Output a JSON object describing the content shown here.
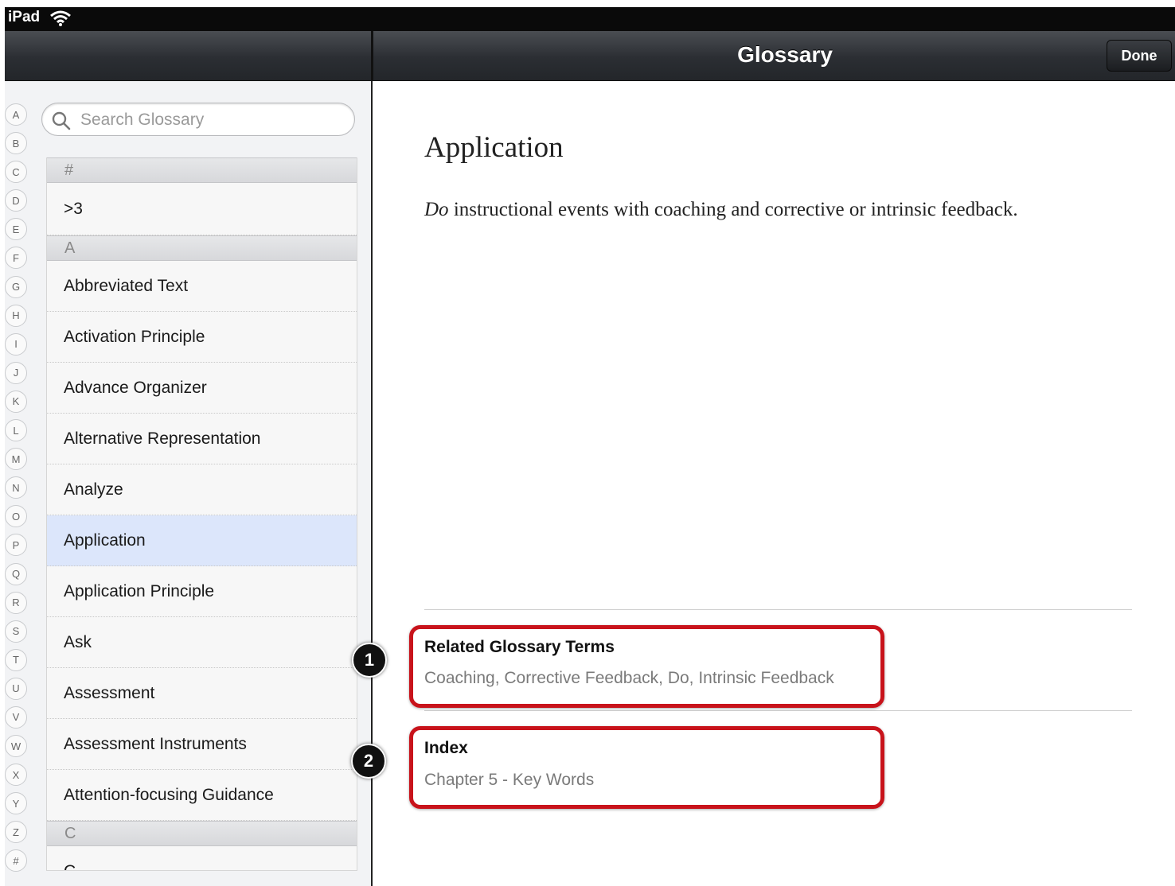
{
  "status_bar": {
    "carrier": "iPad"
  },
  "nav": {
    "title": "Glossary",
    "done_label": "Done"
  },
  "index_letters": [
    "A",
    "B",
    "C",
    "D",
    "E",
    "F",
    "G",
    "H",
    "I",
    "J",
    "K",
    "L",
    "M",
    "N",
    "O",
    "P",
    "Q",
    "R",
    "S",
    "T",
    "U",
    "V",
    "W",
    "X",
    "Y",
    "Z",
    "#"
  ],
  "search": {
    "placeholder": "Search Glossary"
  },
  "list": {
    "sections": [
      {
        "header": "#",
        "items": [
          ">3"
        ]
      },
      {
        "header": "A",
        "items": [
          "Abbreviated Text",
          "Activation Principle",
          "Advance Organizer",
          "Alternative Representation",
          "Analyze",
          "Application",
          "Application Principle",
          "Ask",
          "Assessment",
          "Assessment Instruments",
          "Attention-focusing Guidance"
        ]
      },
      {
        "header": "C",
        "items": [
          "C"
        ]
      }
    ],
    "selected": "Application"
  },
  "entry": {
    "term": "Application",
    "definition_italic": "Do",
    "definition_rest": " instructional events with coaching and corrective or intrinsic feedback.",
    "related_title": "Related Glossary Terms",
    "related_terms": "Coaching, Corrective Feedback, Do, Intrinsic Feedback",
    "index_title": "Index",
    "index_value": "Chapter 5 - Key Words"
  },
  "callouts": {
    "one": "1",
    "two": "2",
    "color": "#c8131b"
  }
}
